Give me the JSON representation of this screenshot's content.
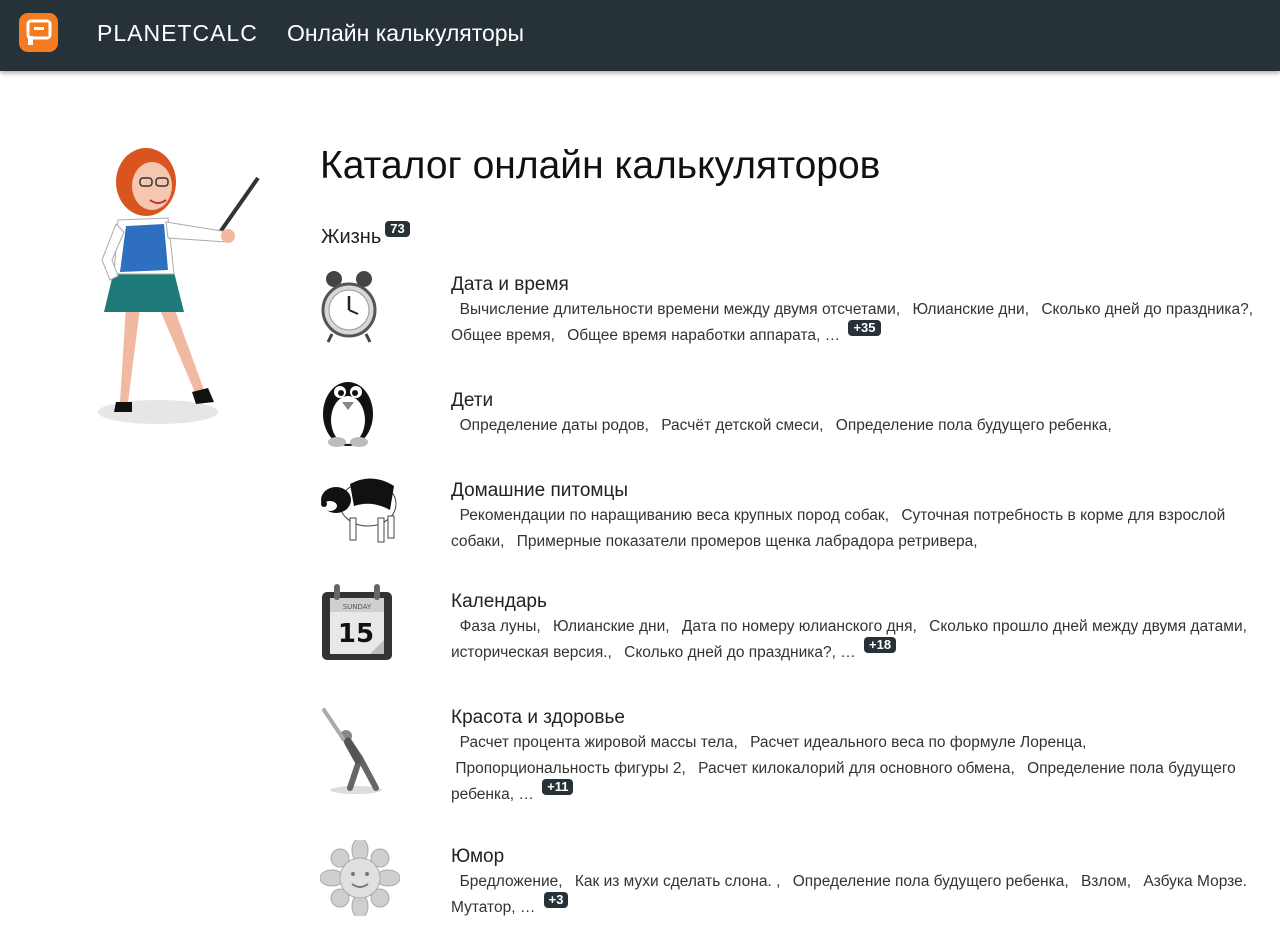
{
  "header": {
    "brand": "PLANETCALC",
    "nav_title": "Онлайн калькуляторы"
  },
  "page": {
    "title": "Каталог онлайн калькуляторов"
  },
  "section": {
    "name": "Жизнь",
    "count": "73"
  },
  "categories": [
    {
      "title": "Дата и время",
      "icon": "alarm-clock-icon",
      "links": [
        "Вычисление длительности времени между двумя отсчетами",
        "Юлианские дни",
        "Сколько дней до праздника?",
        "Общее время",
        "Общее время наработки аппарата"
      ],
      "more": "+35"
    },
    {
      "title": "Дети",
      "icon": "penguin-icon",
      "links": [
        "Определение даты родов",
        "Расчёт детской смеси",
        "Определение пола будущего ребенка"
      ],
      "more": ""
    },
    {
      "title": "Домашние питомцы",
      "icon": "dog-icon",
      "links": [
        "Рекомендации по наращиванию веса крупных пород собак",
        "Суточная потребность в корме для взрослой собаки",
        "Примерные показатели промеров щенка лабрадора ретривера"
      ],
      "more": ""
    },
    {
      "title": "Календарь",
      "icon": "calendar-icon",
      "calendar_day": "15",
      "calendar_weekday": "SUNDAY",
      "links": [
        "Фаза луны",
        "Юлианские дни",
        "Дата по номеру юлианского дня",
        "Сколько прошло дней между двумя датами, историческая версия.",
        "Сколько дней до праздника?"
      ],
      "more": "+18"
    },
    {
      "title": "Красота и здоровье",
      "icon": "stretching-figure-icon",
      "links": [
        "Расчет процента жировой массы тела",
        "Расчет идеального веса по формуле Лоренца",
        "Пропорциональность фигуры 2",
        "Расчет килокалорий для основного обмена",
        "Определение пола будущего ребенка"
      ],
      "more": "+11"
    },
    {
      "title": "Юмор",
      "icon": "smiling-sun-icon",
      "links": [
        "Бредложение",
        "Как из мухи сделать слона. ",
        "Определение пола будущего ребенка",
        "Взлом",
        "Азбука Морзе. Мутатор"
      ],
      "more": "+3"
    }
  ]
}
